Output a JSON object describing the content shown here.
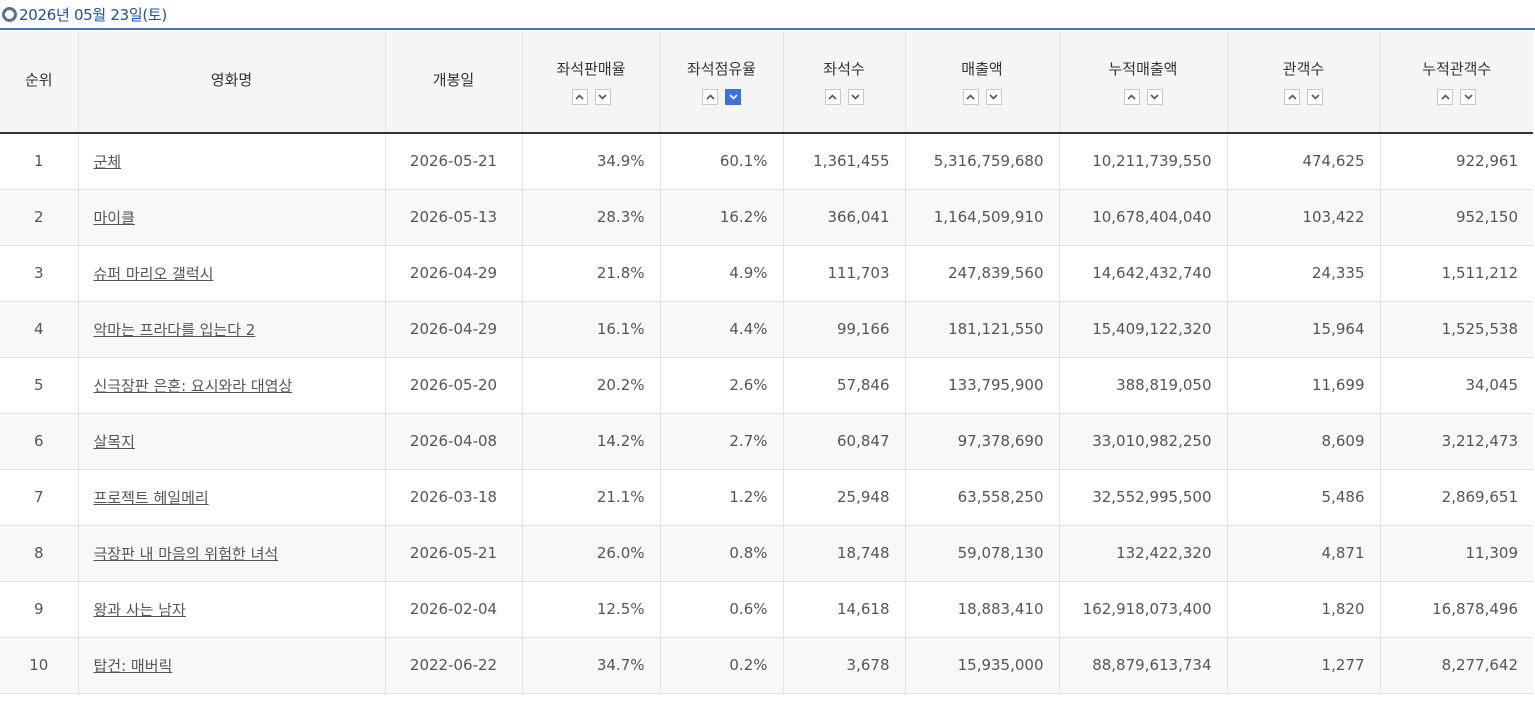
{
  "date_label": "2026년 05월 23일(토)",
  "headers": [
    {
      "label": "순위",
      "sortable": false
    },
    {
      "label": "영화명",
      "sortable": false
    },
    {
      "label": "개봉일",
      "sortable": false
    },
    {
      "label": "좌석판매율",
      "sortable": true,
      "active": false
    },
    {
      "label": "좌석점유율",
      "sortable": true,
      "active": true
    },
    {
      "label": "좌석수",
      "sortable": true,
      "active": false
    },
    {
      "label": "매출액",
      "sortable": true,
      "active": false
    },
    {
      "label": "누적매출액",
      "sortable": true,
      "active": false
    },
    {
      "label": "관객수",
      "sortable": true,
      "active": false
    },
    {
      "label": "누적관객수",
      "sortable": true,
      "active": false
    }
  ],
  "rows": [
    {
      "rank": "1",
      "title": "군체",
      "open_date": "2026-05-21",
      "seat_sales_rate": "34.9%",
      "seat_share": "60.1%",
      "seats": "1,361,455",
      "sales": "5,316,759,680",
      "cum_sales": "10,211,739,550",
      "audience": "474,625",
      "cum_audience": "922,961"
    },
    {
      "rank": "2",
      "title": "마이클",
      "open_date": "2026-05-13",
      "seat_sales_rate": "28.3%",
      "seat_share": "16.2%",
      "seats": "366,041",
      "sales": "1,164,509,910",
      "cum_sales": "10,678,404,040",
      "audience": "103,422",
      "cum_audience": "952,150"
    },
    {
      "rank": "3",
      "title": "슈퍼 마리오 갤럭시",
      "open_date": "2026-04-29",
      "seat_sales_rate": "21.8%",
      "seat_share": "4.9%",
      "seats": "111,703",
      "sales": "247,839,560",
      "cum_sales": "14,642,432,740",
      "audience": "24,335",
      "cum_audience": "1,511,212"
    },
    {
      "rank": "4",
      "title": "악마는 프라다를 입는다 2",
      "open_date": "2026-04-29",
      "seat_sales_rate": "16.1%",
      "seat_share": "4.4%",
      "seats": "99,166",
      "sales": "181,121,550",
      "cum_sales": "15,409,122,320",
      "audience": "15,964",
      "cum_audience": "1,525,538"
    },
    {
      "rank": "5",
      "title": "신극장판 은혼: 요시와라 대염상",
      "open_date": "2026-05-20",
      "seat_sales_rate": "20.2%",
      "seat_share": "2.6%",
      "seats": "57,846",
      "sales": "133,795,900",
      "cum_sales": "388,819,050",
      "audience": "11,699",
      "cum_audience": "34,045"
    },
    {
      "rank": "6",
      "title": "살목지",
      "open_date": "2026-04-08",
      "seat_sales_rate": "14.2%",
      "seat_share": "2.7%",
      "seats": "60,847",
      "sales": "97,378,690",
      "cum_sales": "33,010,982,250",
      "audience": "8,609",
      "cum_audience": "3,212,473"
    },
    {
      "rank": "7",
      "title": "프로젝트 헤일메리",
      "open_date": "2026-03-18",
      "seat_sales_rate": "21.1%",
      "seat_share": "1.2%",
      "seats": "25,948",
      "sales": "63,558,250",
      "cum_sales": "32,552,995,500",
      "audience": "5,486",
      "cum_audience": "2,869,651"
    },
    {
      "rank": "8",
      "title": "극장판 내 마음의 위험한 녀석",
      "open_date": "2026-05-21",
      "seat_sales_rate": "26.0%",
      "seat_share": "0.8%",
      "seats": "18,748",
      "sales": "59,078,130",
      "cum_sales": "132,422,320",
      "audience": "4,871",
      "cum_audience": "11,309"
    },
    {
      "rank": "9",
      "title": "왕과 사는 남자",
      "open_date": "2026-02-04",
      "seat_sales_rate": "12.5%",
      "seat_share": "0.6%",
      "seats": "14,618",
      "sales": "18,883,410",
      "cum_sales": "162,918,073,400",
      "audience": "1,820",
      "cum_audience": "16,878,496"
    },
    {
      "rank": "10",
      "title": "탑건: 매버릭",
      "open_date": "2022-06-22",
      "seat_sales_rate": "34.7%",
      "seat_share": "0.2%",
      "seats": "3,678",
      "sales": "15,935,000",
      "cum_sales": "88,879,613,734",
      "audience": "1,277",
      "cum_audience": "8,277,642"
    }
  ]
}
